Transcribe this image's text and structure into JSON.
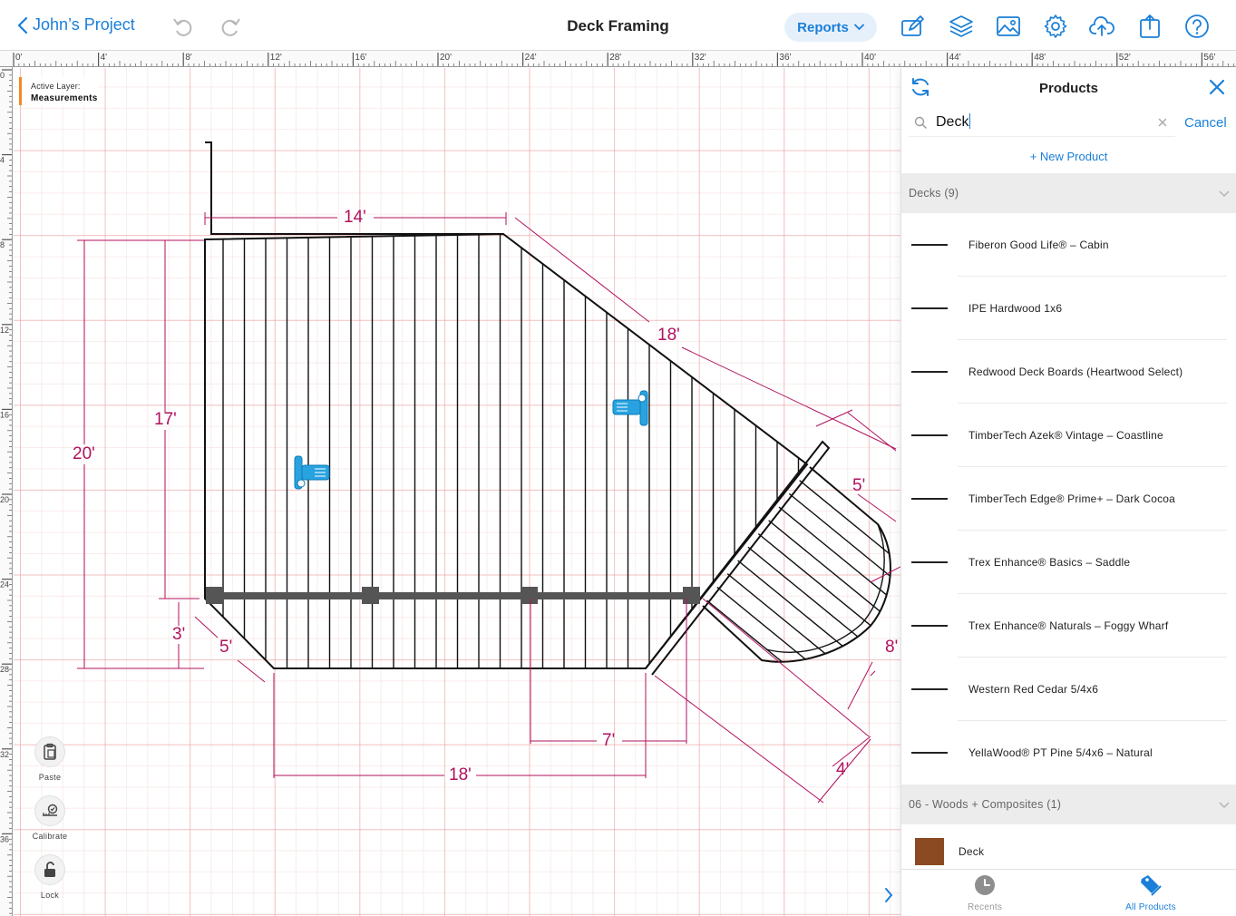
{
  "topbar": {
    "back_label": "John’s Project",
    "title": "Deck Framing",
    "reports_label": "Reports"
  },
  "ruler": {
    "top_labels": [
      "0'",
      "4'",
      "8'",
      "12'",
      "16'",
      "20'",
      "24'",
      "28'",
      "32'",
      "36'",
      "40'",
      "44'",
      "48'",
      "52'",
      "56'"
    ],
    "left_labels": [
      "0",
      "4",
      "8",
      "12",
      "16",
      "20",
      "24",
      "28",
      "32",
      "36"
    ]
  },
  "canvas": {
    "active_layer_label": "Active Layer:",
    "active_layer_value": "Measurements",
    "dimensions": {
      "top_width": "14'",
      "diagonal": "18'",
      "left_outer": "20'",
      "left_inner": "17'",
      "bottom_offset": "3'",
      "bottom_chamfer": "5'",
      "bottom_width": "18'",
      "beam_gap": "7'",
      "bay_side": "5'",
      "bay_depth": "8'",
      "bay_bottom": "4'"
    },
    "dimension_color": "#b0125e",
    "tools": [
      {
        "label": "Paste",
        "icon": "clipboard-icon"
      },
      {
        "label": "Calibrate",
        "icon": "calibrate-icon"
      },
      {
        "label": "Lock",
        "icon": "lock-icon"
      }
    ]
  },
  "panel": {
    "title": "Products",
    "search_value": "Deck",
    "cancel_label": "Cancel",
    "new_product_label": "+  New Product",
    "section1": "Decks (9)",
    "items": [
      "Fiberon Good Life® – Cabin",
      "IPE Hardwood 1x6",
      "Redwood Deck Boards (Heartwood Select)",
      "TimberTech Azek® Vintage – Coastline",
      "TimberTech Edge® Prime+ – Dark Cocoa",
      "Trex Enhance® Basics – Saddle",
      "Trex Enhance® Naturals – Foggy Wharf",
      "Western Red Cedar 5/4x6",
      "YellaWood® PT Pine 5/4x6 – Natural"
    ],
    "section2": "06 - Woods + Composites (1)",
    "section2_items": [
      {
        "name": "Deck",
        "swatch": "#8b4a22"
      }
    ],
    "tabs": {
      "recents": "Recents",
      "all_products": "All Products"
    }
  },
  "colors": {
    "accent": "#1a7fd8",
    "layer_marker": "#f08a24",
    "hardware": "#29a3e0"
  }
}
